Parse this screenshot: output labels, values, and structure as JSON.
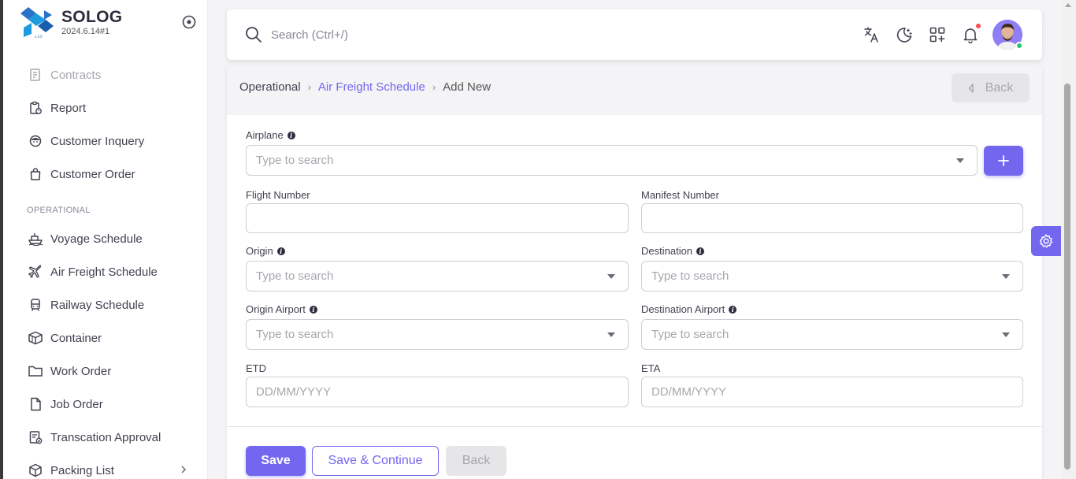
{
  "brand": {
    "name": "SOLOG",
    "version": "2024.6.14#1"
  },
  "sidebar": {
    "items_top": [
      {
        "label": "Contracts",
        "icon": "contract-icon",
        "disabled": true
      },
      {
        "label": "Report",
        "icon": "report-icon"
      },
      {
        "label": "Customer Inquery",
        "icon": "customer-inquiry-icon"
      },
      {
        "label": "Customer Order",
        "icon": "shopping-bag-icon"
      }
    ],
    "section_operational": "OPERATIONAL",
    "items_operational": [
      {
        "label": "Voyage Schedule",
        "icon": "ship-icon"
      },
      {
        "label": "Air Freight Schedule",
        "icon": "plane-icon"
      },
      {
        "label": "Railway Schedule",
        "icon": "train-icon"
      },
      {
        "label": "Container",
        "icon": "box-icon"
      },
      {
        "label": "Work Order",
        "icon": "folder-icon"
      },
      {
        "label": "Job Order",
        "icon": "file-icon"
      },
      {
        "label": "Transcation Approval",
        "icon": "approval-icon"
      },
      {
        "label": "Packing List",
        "icon": "package-icon"
      }
    ]
  },
  "topbar": {
    "search_placeholder": "Search (Ctrl+/)"
  },
  "breadcrumb": {
    "level1": "Operational",
    "level2": "Air Freight Schedule",
    "level3": "Add New"
  },
  "header_back_label": "Back",
  "form": {
    "airplane": {
      "label": "Airplane",
      "placeholder": "Type to search"
    },
    "flight_number": {
      "label": "Flight Number",
      "value": ""
    },
    "manifest_number": {
      "label": "Manifest Number",
      "value": ""
    },
    "origin": {
      "label": "Origin",
      "placeholder": "Type to search"
    },
    "destination": {
      "label": "Destination",
      "placeholder": "Type to search"
    },
    "origin_airport": {
      "label": "Origin Airport",
      "placeholder": "Type to search"
    },
    "destination_airport": {
      "label": "Destination Airport",
      "placeholder": "Type to search"
    },
    "etd": {
      "label": "ETD",
      "placeholder": "DD/MM/YYYY"
    },
    "eta": {
      "label": "ETA",
      "placeholder": "DD/MM/YYYY"
    }
  },
  "actions": {
    "save": "Save",
    "save_continue": "Save & Continue",
    "back": "Back"
  },
  "colors": {
    "primary": "#7367f0",
    "text": "#444050",
    "notification": "#ff4c51",
    "online": "#28c76f"
  }
}
